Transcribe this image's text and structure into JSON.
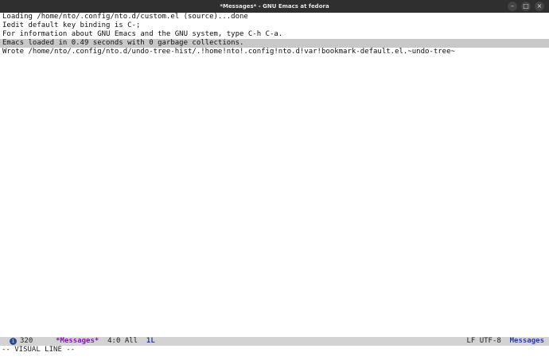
{
  "window": {
    "title": "*Messages* - GNU Emacs at fedora",
    "buttons": {
      "minimize": "–",
      "maximize": "□",
      "close": "×"
    }
  },
  "buffer": {
    "lines": [
      "Loading /home/nto/.config/nto.d/custom.el (source)...done",
      "Iedit default key binding is C-;",
      "For information about GNU Emacs and the GNU system, type C-h C-a.",
      "Emacs loaded in 0.49 seconds with 0 garbage collections.",
      "Wrote /home/nto/.config/nto.d/undo-tree-hist/.!home!nto!.config!nto.d!var!bookmark-default.el.~undo-tree~"
    ],
    "highlighted_line_index": 3
  },
  "modeline": {
    "state_icon": "i",
    "size": "320",
    "file_icon": "document-icon",
    "lock_icon": "lock-icon",
    "buffer_name": "*Messages*",
    "position": "4:0 All",
    "line_count": "1L",
    "encoding": "LF UTF-8",
    "major_mode": "Messages"
  },
  "echo_area": {
    "text": "-- VISUAL LINE --"
  }
}
